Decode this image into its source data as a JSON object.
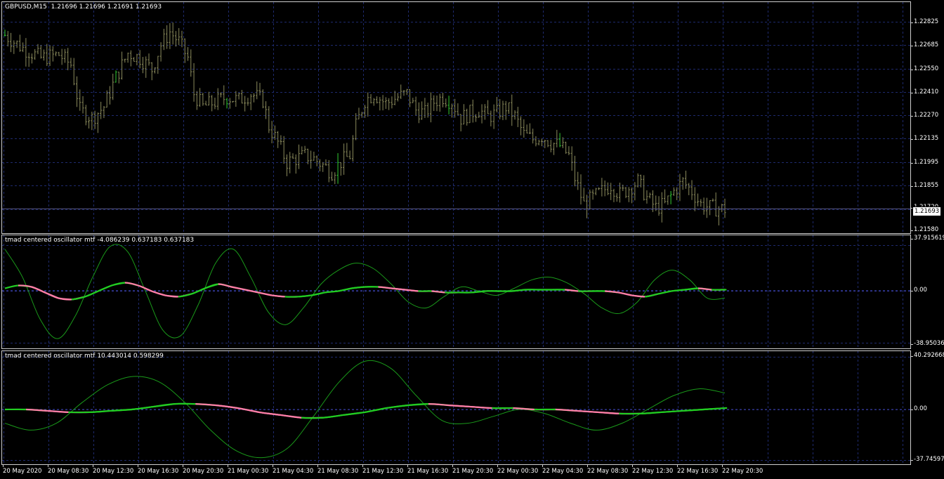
{
  "window": {
    "symbol_label": "GBPUSD,M15  1.21696 1.21696 1.21691 1.21693",
    "osc1_label": "tmad centered oscillator mtf -4.086239 0.637183 0.637183",
    "osc2_label": "tmad centered oscillator mtf 10.443014 0.598299",
    "current_price": "1.21693"
  },
  "colors": {
    "background": "#000000",
    "grid": "#1e2a6e",
    "bar": "#8a8a5c",
    "bar_up": "#33cc33",
    "line_pink": "#ff7fa8",
    "line_green_thick": "#22cc22",
    "line_green_thin": "#1a9a1a",
    "zero_line": "#3a3aa0"
  },
  "price_axis": [
    "1.22825",
    "1.22685",
    "1.22550",
    "1.22410",
    "1.22270",
    "1.22135",
    "1.21995",
    "1.21855",
    "1.21720",
    "1.21580"
  ],
  "osc1_axis": [
    "37.915619",
    "0.00",
    "-38.95036"
  ],
  "osc2_axis": [
    "40.292668",
    "0.00",
    "-37.74597"
  ],
  "time_axis": [
    "20 May 2020",
    "20 May 08:30",
    "20 May 12:30",
    "20 May 16:30",
    "20 May 20:30",
    "21 May 00:30",
    "21 May 04:30",
    "21 May 08:30",
    "21 May 12:30",
    "21 May 16:30",
    "21 May 20:30",
    "22 May 00:30",
    "22 May 04:30",
    "22 May 08:30",
    "22 May 12:30",
    "22 May 16:30",
    "22 May 20:30"
  ],
  "chart_data": [
    {
      "type": "ohlc",
      "pane": "price",
      "ylim": [
        1.2156,
        1.2292
      ],
      "close_path": [
        [
          0,
          1.2276
        ],
        [
          6,
          1.2268
        ],
        [
          12,
          1.2262
        ],
        [
          18,
          1.2264
        ],
        [
          22,
          1.2258
        ],
        [
          25,
          1.223
        ],
        [
          29,
          1.2225
        ],
        [
          33,
          1.2232
        ],
        [
          37,
          1.225
        ],
        [
          41,
          1.2265
        ],
        [
          45,
          1.2262
        ],
        [
          49,
          1.2255
        ],
        [
          52,
          1.227
        ],
        [
          55,
          1.2278
        ],
        [
          58,
          1.2272
        ],
        [
          61,
          1.2262
        ],
        [
          63,
          1.224
        ],
        [
          66,
          1.2232
        ],
        [
          70,
          1.2235
        ],
        [
          74,
          1.2238
        ],
        [
          78,
          1.2236
        ],
        [
          82,
          1.224
        ],
        [
          86,
          1.2236
        ],
        [
          88,
          1.222
        ],
        [
          91,
          1.221
        ],
        [
          94,
          1.2198
        ],
        [
          97,
          1.22
        ],
        [
          100,
          1.2202
        ],
        [
          103,
          1.22
        ],
        [
          106,
          1.2196
        ],
        [
          109,
          1.2192
        ],
        [
          112,
          1.2198
        ],
        [
          115,
          1.2202
        ],
        [
          117,
          1.222
        ],
        [
          120,
          1.2236
        ],
        [
          123,
          1.224
        ],
        [
          127,
          1.2234
        ],
        [
          131,
          1.2238
        ],
        [
          134,
          1.224
        ],
        [
          137,
          1.223
        ],
        [
          140,
          1.2228
        ],
        [
          143,
          1.2235
        ],
        [
          146,
          1.2238
        ],
        [
          149,
          1.2235
        ],
        [
          152,
          1.2225
        ],
        [
          155,
          1.2228
        ],
        [
          158,
          1.223
        ],
        [
          161,
          1.2226
        ],
        [
          164,
          1.2228
        ],
        [
          167,
          1.2232
        ],
        [
          170,
          1.2226
        ],
        [
          173,
          1.2215
        ],
        [
          176,
          1.2212
        ],
        [
          179,
          1.2214
        ],
        [
          182,
          1.221
        ],
        [
          185,
          1.2208
        ],
        [
          188,
          1.2202
        ],
        [
          190,
          1.2188
        ],
        [
          193,
          1.2172
        ],
        [
          196,
          1.2176
        ],
        [
          199,
          1.218
        ],
        [
          202,
          1.2184
        ],
        [
          205,
          1.2178
        ],
        [
          208,
          1.2182
        ],
        [
          211,
          1.2186
        ],
        [
          214,
          1.2176
        ],
        [
          217,
          1.217
        ],
        [
          220,
          1.2172
        ],
        [
          223,
          1.218
        ],
        [
          226,
          1.2186
        ],
        [
          229,
          1.218
        ],
        [
          232,
          1.2172
        ],
        [
          235,
          1.217
        ],
        [
          240,
          1.2169
        ]
      ]
    },
    {
      "type": "line",
      "pane": "osc1",
      "ylim": [
        -38.95036,
        37.915619
      ],
      "series": [
        {
          "role": "pink-thick",
          "values": [
            2,
            4,
            3,
            -1,
            -5,
            -6,
            -4,
            0,
            4,
            6,
            4,
            0,
            -3,
            -4,
            -2,
            2,
            5,
            3,
            1,
            -1,
            -3,
            -4,
            -4,
            -3,
            -1,
            0,
            2,
            3,
            3,
            2,
            1,
            0,
            0,
            -1,
            -1,
            -1,
            0,
            0,
            0,
            1,
            1,
            1,
            1,
            0,
            0,
            0,
            -1,
            -3,
            -4,
            -2,
            0,
            1,
            2,
            1,
            1
          ]
        },
        {
          "role": "green-thick",
          "values": [
            2,
            4,
            3,
            -1,
            -5,
            -6,
            -4,
            0,
            4,
            6,
            4,
            0,
            -3,
            -4,
            -2,
            2,
            5,
            3,
            1,
            -1,
            -3,
            -4,
            -4,
            -3,
            -1,
            0,
            2,
            3,
            3,
            2,
            1,
            0,
            0,
            -1,
            -1,
            -1,
            0,
            0,
            0,
            1,
            1,
            1,
            1,
            0,
            0,
            0,
            -1,
            -3,
            -4,
            -2,
            0,
            1,
            2,
            1,
            1
          ]
        },
        {
          "role": "green-thin",
          "values": [
            30,
            10,
            -20,
            -34,
            -18,
            10,
            32,
            28,
            0,
            -28,
            -32,
            -10,
            20,
            30,
            10,
            -15,
            -24,
            -12,
            5,
            15,
            20,
            16,
            5,
            -8,
            -12,
            -4,
            3,
            0,
            -3,
            2,
            8,
            10,
            6,
            -2,
            -12,
            -16,
            -8,
            8,
            15,
            8,
            -5,
            -5
          ]
        }
      ]
    },
    {
      "type": "line",
      "pane": "osc2",
      "ylim": [
        -37.74597,
        40.292668
      ],
      "series": [
        {
          "role": "pink-thick",
          "values": [
            0,
            0,
            -1,
            -2,
            -2,
            -1,
            0,
            2,
            4,
            4,
            3,
            1,
            -2,
            -4,
            -6,
            -6,
            -4,
            -2,
            1,
            3,
            4,
            3,
            2,
            1,
            1,
            0,
            0,
            -1,
            -2,
            -3,
            -3,
            -2,
            -1,
            0,
            1
          ]
        },
        {
          "role": "green-thick",
          "values": [
            0,
            0,
            -1,
            -2,
            -2,
            -1,
            0,
            2,
            4,
            4,
            3,
            1,
            -2,
            -4,
            -6,
            -6,
            -4,
            -2,
            1,
            3,
            4,
            3,
            2,
            1,
            1,
            0,
            0,
            -1,
            -2,
            -3,
            -3,
            -2,
            -1,
            0,
            1
          ]
        },
        {
          "role": "green-thin",
          "values": [
            -10,
            -15,
            -10,
            5,
            18,
            24,
            20,
            5,
            -15,
            -30,
            -35,
            -28,
            -5,
            20,
            35,
            30,
            10,
            -8,
            -10,
            -5,
            0,
            -3,
            -10,
            -15,
            -10,
            0,
            10,
            15,
            12
          ]
        }
      ]
    }
  ]
}
